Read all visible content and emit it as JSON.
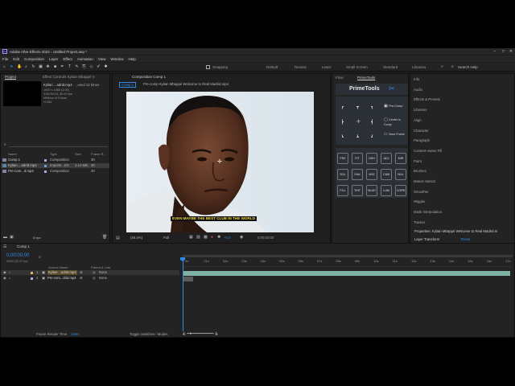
{
  "app": {
    "title": "Adobe After Effects 2024 - Untitled Project.aep *",
    "logo_text": "Ae"
  },
  "menu": [
    "File",
    "Edit",
    "Composition",
    "Layer",
    "Effect",
    "Animation",
    "View",
    "Window",
    "Help"
  ],
  "toolbar": {
    "snapping_label": "Snapping",
    "workspaces": [
      "Default",
      "Review",
      "Learn",
      "Small Screen",
      "Standard",
      "Libraries"
    ],
    "search_placeholder": "Search Help"
  },
  "project_panel": {
    "tab_project": "Project",
    "tab_effect_controls": "Effect Controls Kylian Mbappé V",
    "selected_name": "Kylian ...adrid.mp4",
    "selected_used": ", used 12 times",
    "selected_info": [
      "1920 x 1080 (1.00)",
      "0;00;09;10, 30.00 fps",
      "Millions of Colors",
      "H.264",
      "48.000 kHz"
    ],
    "search_placeholder": "",
    "columns": {
      "name": "Name",
      "type": "Type",
      "size": "Size",
      "frame_rate": "Frame R..."
    },
    "items": [
      {
        "name": "Comp 1",
        "type": "Composition",
        "size": "",
        "frame_rate": "30",
        "color": "#b4a6d9",
        "selected": false
      },
      {
        "name": "Kylian ...adrid.mp4",
        "type": "Importe...EX",
        "size": "3.14 MB",
        "frame_rate": "30",
        "color": "#6ea0d6",
        "selected": true
      },
      {
        "name": "Pre-com...d.mp4",
        "type": "Composition",
        "size": "",
        "frame_rate": "30",
        "color": "#b4a6d9",
        "selected": false
      }
    ],
    "bpc": "8 bpc"
  },
  "composition_panel": {
    "tab_label": "Composition Comp 1",
    "breadcrumb_comp": "Comp 1",
    "breadcrumb_precomp": "Pre-comp Kylian Mbappé Welcome to Real Madrid.mp4",
    "subtitle": "EVEN MAYBE THE BEST CLUB IN THE WORLD",
    "zoom": "(46.4%)",
    "resolution": "Full",
    "exposure": "+0.0",
    "timecode": "0;00;00;00"
  },
  "flow_panel": {
    "tab_flow": "Flow",
    "tab_primetools": "PrimeTools"
  },
  "primetools": {
    "logo": "PrimeTools",
    "precomp_label": "Pre-Comp",
    "center_label": "Center In Comp",
    "save_label": "Save Frame",
    "buttons_row1": [
      "FRZ",
      "FIT",
      "DSH",
      "ADJ",
      "MIR"
    ],
    "buttons_row2": [
      "SOL",
      "SHA",
      "WIG",
      "CAM",
      "NUL"
    ],
    "buttons_row3": [
      "FILL",
      "TINT",
      "BLUR",
      "LUM",
      "CORR"
    ]
  },
  "right_panel": {
    "tabs": [
      "Info",
      "Audio",
      "Effects & Presets",
      "Libraries",
      "Align",
      "Character",
      "Paragraph",
      "Content-Aware Fill",
      "Paint",
      "Brushes",
      "Motion Sketch",
      "Smoother",
      "Wiggler",
      "Mask Interpolation",
      "Tracker"
    ],
    "properties_label": "Properties: Kylian Mbappé Welcome to Real Madrid.m",
    "layer_transform": "Layer Transform",
    "reset": "Reset"
  },
  "timeline": {
    "tab_label": "Comp 1",
    "timecode": "0;00;00;00",
    "timecode_sub": "00000 (30.00 fps)",
    "columns": {
      "source_name": "Source Name",
      "parent": "Parent & Link"
    },
    "layers": [
      {
        "num": "1",
        "name": "Kylian ...adrid.mp4",
        "parent": "None",
        "color": "#d8b96a",
        "selected": true
      },
      {
        "num": "2",
        "name": "Pre-com...drid.mp4",
        "parent": "None",
        "color": "#b4a6d9",
        "selected": false
      }
    ],
    "ruler_ticks": [
      "0s",
      "01s",
      "02s",
      "03s",
      "04s",
      "05s",
      "06s",
      "07s",
      "08s",
      "09s",
      "10s",
      "11s",
      "12s",
      "13s",
      "14s",
      "15s",
      "16s",
      "17s"
    ],
    "frame_render_label": "Frame Render Time",
    "frame_render_value": "14ms",
    "toggle_label": "Toggle Switches / Modes"
  }
}
